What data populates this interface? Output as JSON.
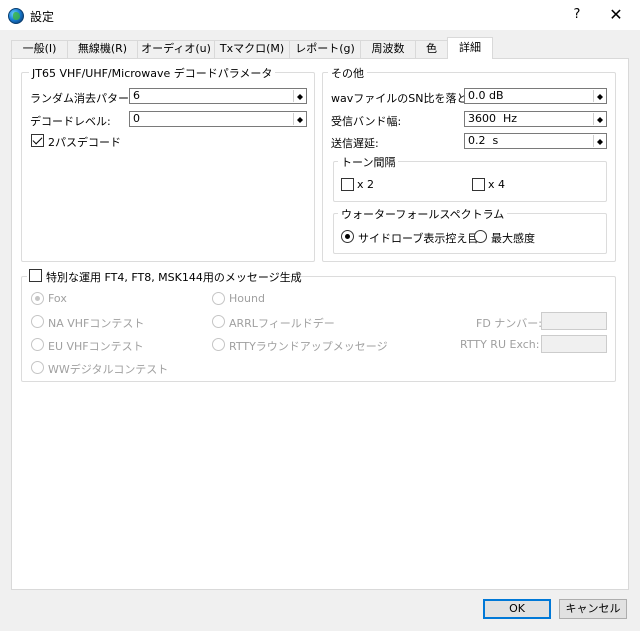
{
  "window": {
    "title": "設定",
    "help_label": "?",
    "close_label": "✕",
    "icon": "globe-icon"
  },
  "tabs": [
    "一般(I)",
    "無線機(R)",
    "オーディオ(u)",
    "Txマクロ(M)",
    "レポート(g)",
    "周波数",
    "色",
    "詳細"
  ],
  "jt65": {
    "title": "JT65 VHF/UHF/Microwave デコードパラメータ",
    "random_erasure_label": "ランダム消去パターン:",
    "random_erasure_value": "6",
    "decode_level_label": "デコードレベル:",
    "decode_level_value": "0",
    "two_pass_label": "2パスデコード"
  },
  "misc": {
    "title": "その他",
    "wav_label": "wavファイルのSN比を落とす:",
    "wav_value": "0.0 dB",
    "bandwidth_label": "受信バンド幅:",
    "bandwidth_value": "3600  Hz",
    "tx_delay_label": "送信遅延:",
    "tx_delay_value": "0.2  s"
  },
  "tone": {
    "title": "トーン間隔",
    "x2_label": "x 2",
    "x4_label": "x 4"
  },
  "waterfall": {
    "title": "ウォーターフォールスペクトラム",
    "sidelobe_label": "サイドローブ表示控え目",
    "max_sens_label": "最大感度"
  },
  "special": {
    "title": "特別な運用  FT4, FT8, MSK144用のメッセージ生成",
    "fox": "Fox",
    "hound": "Hound",
    "na_vhf": "NA VHFコンテスト",
    "arrl_fd": "ARRLフィールドデー",
    "fd_number_label": "FD ナンバー:",
    "eu_vhf": "EU VHFコンテスト",
    "rtty_roundup": "RTTYラウンドアップメッセージ",
    "rtty_exch_label": "RTTY RU Exch:",
    "ww_digi": "WWデジタルコンテスト"
  },
  "buttons": {
    "ok": "OK",
    "cancel": "キャンセル"
  }
}
